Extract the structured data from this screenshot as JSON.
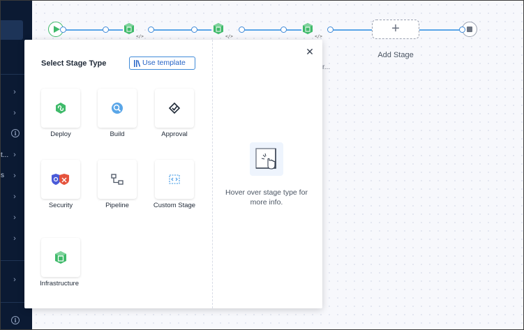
{
  "sidenav": {
    "fragments": [
      "t...",
      "s"
    ]
  },
  "pipeline": {
    "add_stage_plus": "+",
    "add_stage_label": "Add Stage",
    "truncated_stage_name": "r...",
    "code_glyph": "</>"
  },
  "modal": {
    "title": "Select Stage Type",
    "use_template_label": "Use template",
    "close_glyph": "✕",
    "stage_types": [
      {
        "label": "Deploy",
        "icon": "deploy-icon"
      },
      {
        "label": "Build",
        "icon": "build-icon"
      },
      {
        "label": "Approval",
        "icon": "approval-icon"
      },
      {
        "label": "Security",
        "icon": "security-icon"
      },
      {
        "label": "Pipeline",
        "icon": "pipeline-icon"
      },
      {
        "label": "Custom Stage",
        "icon": "custom-stage-icon"
      },
      {
        "label": "Infrastructure",
        "icon": "infrastructure-icon"
      }
    ],
    "hover_hint": "Hover over stage type for more info."
  },
  "colors": {
    "nav_bg": "#0b1a33",
    "pipeline_line": "#5aa6e8",
    "accent_blue": "#3f8ad8",
    "green": "#3fba6a"
  }
}
